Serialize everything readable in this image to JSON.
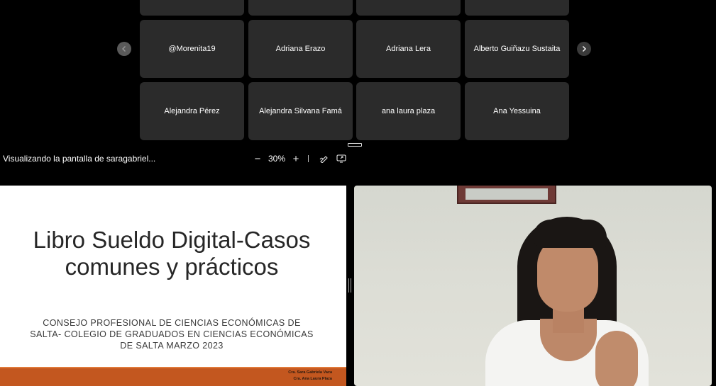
{
  "participants_top_row": [
    "",
    "",
    "",
    ""
  ],
  "participants": [
    [
      "@Morenita19",
      "Adriana Erazo",
      "Adriana Lera",
      "Alberto Guiñazu Sustaita"
    ],
    [
      "Alejandra Pérez",
      "Alejandra Silvana Famá",
      "ana laura plaza",
      "Ana Yessuina"
    ]
  ],
  "nav": {
    "prev_icon": "chevron-left-icon",
    "next_icon": "chevron-right-icon"
  },
  "share": {
    "label": "Visualizando la pantalla de saragabriel...",
    "zoom_out": "−",
    "zoom_value": "30%",
    "zoom_in": "+",
    "annotate_icon": "pen-icon",
    "popout_icon": "pop-out-screen-icon"
  },
  "slide": {
    "title_line1": "Libro Sueldo Digital-Casos",
    "title_line2": "comunes y prácticos",
    "subtitle_line1": "CONSEJO PROFESIONAL DE CIENCIAS ECONÓMICAS DE",
    "subtitle_line2": "SALTA- COLEGIO DE GRADUADOS EN CIENCIAS ECONÓMICAS",
    "subtitle_line3": "DE SALTA MARZO 2023",
    "author1": "Cra. Sara Gabriela Vaca",
    "author2": "Cra. Ana Laura Plaza",
    "accent_color": "#c3571f"
  },
  "colors": {
    "background": "#000000",
    "tile": "#2b2b2b",
    "text": "#ffffff"
  }
}
